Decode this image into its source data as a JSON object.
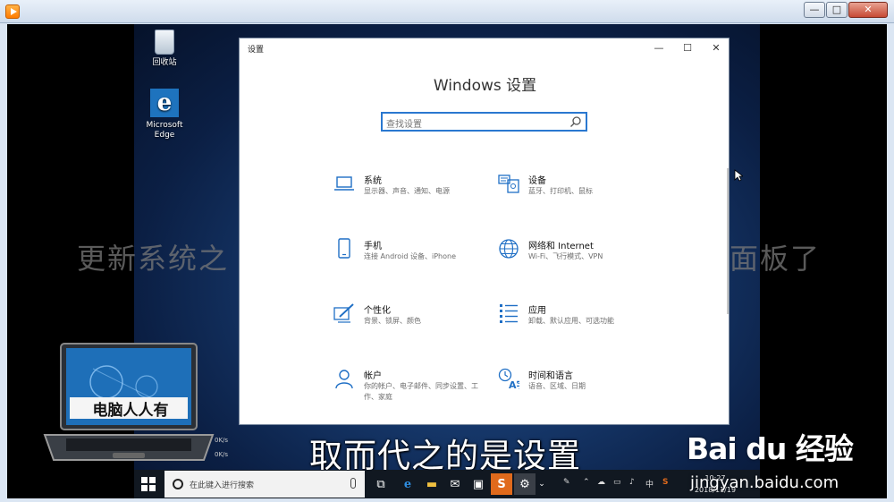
{
  "player": {
    "minimize_label": "—",
    "maximize_label": "□",
    "close_label": "✕"
  },
  "desktop": {
    "icons": [
      {
        "label": "回收站",
        "icon": "recycle-bin-icon"
      },
      {
        "label": "Microsoft Edge",
        "icon": "edge-browser-icon"
      }
    ]
  },
  "overlay": {
    "ghost_left": "更新系统之",
    "ghost_right": "面板了",
    "subtitle": "取而代之的是设置",
    "brand_text": "电脑人人有"
  },
  "settings": {
    "window_title": "设置",
    "heading": "Windows 设置",
    "search_placeholder": "查找设置",
    "controls": {
      "minimize": "—",
      "maximize": "☐",
      "close": "✕"
    },
    "items": [
      {
        "name": "系统",
        "desc": "显示器、声音、通知、电源",
        "icon": "laptop-icon"
      },
      {
        "name": "设备",
        "desc": "蓝牙、打印机、鼠标",
        "icon": "keyboard-printer-icon"
      },
      {
        "name": "手机",
        "desc": "连接 Android 设备、iPhone",
        "icon": "phone-icon"
      },
      {
        "name": "网络和 Internet",
        "desc": "Wi-Fi、飞行模式、VPN",
        "icon": "globe-icon"
      },
      {
        "name": "个性化",
        "desc": "背景、锁屏、颜色",
        "icon": "paint-brush-icon"
      },
      {
        "name": "应用",
        "desc": "卸载、默认应用、可选功能",
        "icon": "apps-list-icon"
      },
      {
        "name": "帐户",
        "desc": "你的帐户、电子邮件、同步设置、工作、家庭",
        "icon": "person-icon"
      },
      {
        "name": "时间和语言",
        "desc": "语音、区域、日期",
        "icon": "time-language-icon"
      }
    ]
  },
  "taskbar": {
    "search_text": "在此键入进行搜索",
    "tray_lang": "中",
    "clock_time": "10:27",
    "clock_date": "2018/11/19",
    "net_up": "0K/s",
    "net_down": "0K/s"
  },
  "watermark": {
    "logo": "Bai du 经验",
    "url": "jingyan.baidu.com"
  },
  "colors": {
    "accent": "#2a78d0",
    "taskbar": "#111821",
    "settings_icon": "#1f6fc5"
  }
}
